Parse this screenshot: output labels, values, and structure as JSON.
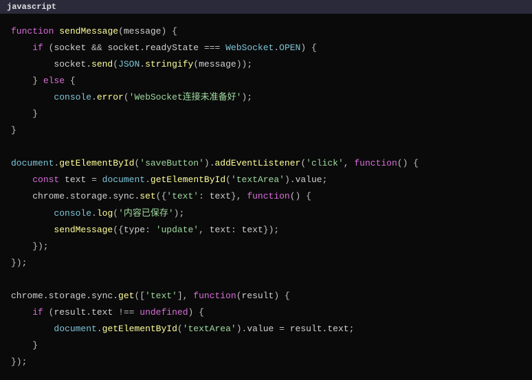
{
  "header": {
    "language": "javascript"
  },
  "code": {
    "tokens": [
      [
        {
          "t": "function",
          "c": "kw"
        },
        {
          "t": " ",
          "c": "punct"
        },
        {
          "t": "sendMessage",
          "c": "fn"
        },
        {
          "t": "(",
          "c": "punct"
        },
        {
          "t": "message",
          "c": "ident"
        },
        {
          "t": ") {",
          "c": "punct"
        }
      ],
      [
        {
          "t": "    ",
          "c": "punct"
        },
        {
          "t": "if",
          "c": "kw"
        },
        {
          "t": " (",
          "c": "punct"
        },
        {
          "t": "socket",
          "c": "ident"
        },
        {
          "t": " && ",
          "c": "op"
        },
        {
          "t": "socket.readyState",
          "c": "ident"
        },
        {
          "t": " === ",
          "c": "op"
        },
        {
          "t": "WebSocket",
          "c": "builtin"
        },
        {
          "t": ".",
          "c": "punct"
        },
        {
          "t": "OPEN",
          "c": "builtin"
        },
        {
          "t": ") {",
          "c": "punct"
        }
      ],
      [
        {
          "t": "        ",
          "c": "punct"
        },
        {
          "t": "socket.",
          "c": "ident"
        },
        {
          "t": "send",
          "c": "fn"
        },
        {
          "t": "(",
          "c": "punct"
        },
        {
          "t": "JSON",
          "c": "builtin"
        },
        {
          "t": ".",
          "c": "punct"
        },
        {
          "t": "stringify",
          "c": "fn"
        },
        {
          "t": "(",
          "c": "punct"
        },
        {
          "t": "message",
          "c": "ident"
        },
        {
          "t": "));",
          "c": "punct"
        }
      ],
      [
        {
          "t": "    } ",
          "c": "punct"
        },
        {
          "t": "else",
          "c": "kw"
        },
        {
          "t": " {",
          "c": "punct"
        }
      ],
      [
        {
          "t": "        ",
          "c": "punct"
        },
        {
          "t": "console",
          "c": "builtin"
        },
        {
          "t": ".",
          "c": "punct"
        },
        {
          "t": "error",
          "c": "fn"
        },
        {
          "t": "(",
          "c": "punct"
        },
        {
          "t": "'WebSocket连接未准备好'",
          "c": "str"
        },
        {
          "t": ");",
          "c": "punct"
        }
      ],
      [
        {
          "t": "    }",
          "c": "punct"
        }
      ],
      [
        {
          "t": "}",
          "c": "punct"
        }
      ],
      [
        {
          "t": "",
          "c": "punct"
        }
      ],
      [
        {
          "t": "document",
          "c": "builtin"
        },
        {
          "t": ".",
          "c": "punct"
        },
        {
          "t": "getElementById",
          "c": "fn"
        },
        {
          "t": "(",
          "c": "punct"
        },
        {
          "t": "'saveButton'",
          "c": "str"
        },
        {
          "t": ").",
          "c": "punct"
        },
        {
          "t": "addEventListener",
          "c": "fn"
        },
        {
          "t": "(",
          "c": "punct"
        },
        {
          "t": "'click'",
          "c": "str"
        },
        {
          "t": ", ",
          "c": "punct"
        },
        {
          "t": "function",
          "c": "kw"
        },
        {
          "t": "() {",
          "c": "punct"
        }
      ],
      [
        {
          "t": "    ",
          "c": "punct"
        },
        {
          "t": "const",
          "c": "kw"
        },
        {
          "t": " ",
          "c": "punct"
        },
        {
          "t": "text",
          "c": "ident"
        },
        {
          "t": " = ",
          "c": "op"
        },
        {
          "t": "document",
          "c": "builtin"
        },
        {
          "t": ".",
          "c": "punct"
        },
        {
          "t": "getElementById",
          "c": "fn"
        },
        {
          "t": "(",
          "c": "punct"
        },
        {
          "t": "'textArea'",
          "c": "str"
        },
        {
          "t": ").",
          "c": "punct"
        },
        {
          "t": "value",
          "c": "ident"
        },
        {
          "t": ";",
          "c": "punct"
        }
      ],
      [
        {
          "t": "    ",
          "c": "punct"
        },
        {
          "t": "chrome.storage.sync.",
          "c": "ident"
        },
        {
          "t": "set",
          "c": "fn"
        },
        {
          "t": "({",
          "c": "punct"
        },
        {
          "t": "'text'",
          "c": "str"
        },
        {
          "t": ": ",
          "c": "punct"
        },
        {
          "t": "text",
          "c": "ident"
        },
        {
          "t": "}, ",
          "c": "punct"
        },
        {
          "t": "function",
          "c": "kw"
        },
        {
          "t": "() {",
          "c": "punct"
        }
      ],
      [
        {
          "t": "        ",
          "c": "punct"
        },
        {
          "t": "console",
          "c": "builtin"
        },
        {
          "t": ".",
          "c": "punct"
        },
        {
          "t": "log",
          "c": "fn"
        },
        {
          "t": "(",
          "c": "punct"
        },
        {
          "t": "'内容已保存'",
          "c": "str"
        },
        {
          "t": ");",
          "c": "punct"
        }
      ],
      [
        {
          "t": "        ",
          "c": "punct"
        },
        {
          "t": "sendMessage",
          "c": "fn"
        },
        {
          "t": "({",
          "c": "punct"
        },
        {
          "t": "type",
          "c": "ident"
        },
        {
          "t": ": ",
          "c": "punct"
        },
        {
          "t": "'update'",
          "c": "str"
        },
        {
          "t": ", ",
          "c": "punct"
        },
        {
          "t": "text",
          "c": "ident"
        },
        {
          "t": ": ",
          "c": "punct"
        },
        {
          "t": "text",
          "c": "ident"
        },
        {
          "t": "});",
          "c": "punct"
        }
      ],
      [
        {
          "t": "    });",
          "c": "punct"
        }
      ],
      [
        {
          "t": "});",
          "c": "punct"
        }
      ],
      [
        {
          "t": "",
          "c": "punct"
        }
      ],
      [
        {
          "t": "chrome.storage.sync.",
          "c": "ident"
        },
        {
          "t": "get",
          "c": "fn"
        },
        {
          "t": "([",
          "c": "punct"
        },
        {
          "t": "'text'",
          "c": "str"
        },
        {
          "t": "], ",
          "c": "punct"
        },
        {
          "t": "function",
          "c": "kw"
        },
        {
          "t": "(",
          "c": "punct"
        },
        {
          "t": "result",
          "c": "ident"
        },
        {
          "t": ") {",
          "c": "punct"
        }
      ],
      [
        {
          "t": "    ",
          "c": "punct"
        },
        {
          "t": "if",
          "c": "kw"
        },
        {
          "t": " (",
          "c": "punct"
        },
        {
          "t": "result.text",
          "c": "ident"
        },
        {
          "t": " !== ",
          "c": "op"
        },
        {
          "t": "undefined",
          "c": "const"
        },
        {
          "t": ") {",
          "c": "punct"
        }
      ],
      [
        {
          "t": "        ",
          "c": "punct"
        },
        {
          "t": "document",
          "c": "builtin"
        },
        {
          "t": ".",
          "c": "punct"
        },
        {
          "t": "getElementById",
          "c": "fn"
        },
        {
          "t": "(",
          "c": "punct"
        },
        {
          "t": "'textArea'",
          "c": "str"
        },
        {
          "t": ").",
          "c": "punct"
        },
        {
          "t": "value",
          "c": "ident"
        },
        {
          "t": " = ",
          "c": "op"
        },
        {
          "t": "result.text",
          "c": "ident"
        },
        {
          "t": ";",
          "c": "punct"
        }
      ],
      [
        {
          "t": "    }",
          "c": "punct"
        }
      ],
      [
        {
          "t": "});",
          "c": "punct"
        }
      ]
    ]
  }
}
